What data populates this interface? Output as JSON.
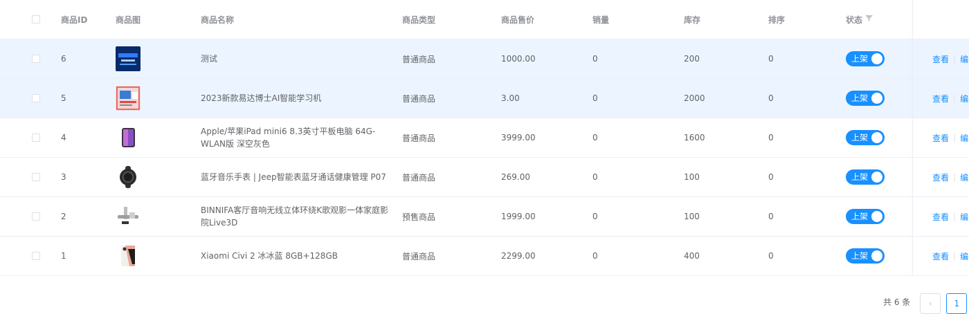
{
  "columns": {
    "id": "商品ID",
    "image": "商品图",
    "name": "商品名称",
    "type": "商品类型",
    "price": "商品售价",
    "sales": "销量",
    "stock": "库存",
    "sort": "排序",
    "status": "状态"
  },
  "rows": [
    {
      "id": "6",
      "name": "测试",
      "type": "普通商品",
      "price": "1000.00",
      "sales": "0",
      "stock": "200",
      "sort": "0",
      "status": "上架",
      "view": "查看",
      "edit": "编"
    },
    {
      "id": "5",
      "name": "2023新款易达博士AI智能学习机",
      "type": "普通商品",
      "price": "3.00",
      "sales": "0",
      "stock": "2000",
      "sort": "0",
      "status": "上架",
      "view": "查看",
      "edit": "编"
    },
    {
      "id": "4",
      "name": "Apple/苹果iPad mini6 8.3英寸平板电脑 64G-WLAN版 深空灰色",
      "type": "普通商品",
      "price": "3999.00",
      "sales": "0",
      "stock": "1600",
      "sort": "0",
      "status": "上架",
      "view": "查看",
      "edit": "编"
    },
    {
      "id": "3",
      "name": "蓝牙音乐手表 | Jeep智能表蓝牙通话健康管理 P07",
      "type": "普通商品",
      "price": "269.00",
      "sales": "0",
      "stock": "100",
      "sort": "0",
      "status": "上架",
      "view": "查看",
      "edit": "编"
    },
    {
      "id": "2",
      "name": "BINNIFA客厅音响无线立体环绕K歌观影一体家庭影院Live3D",
      "type": "预售商品",
      "price": "1999.00",
      "sales": "0",
      "stock": "100",
      "sort": "0",
      "status": "上架",
      "view": "查看",
      "edit": "编"
    },
    {
      "id": "1",
      "name": "Xiaomi Civi 2 冰冰蓝 8GB+128GB",
      "type": "普通商品",
      "price": "2299.00",
      "sales": "0",
      "stock": "400",
      "sort": "0",
      "status": "上架",
      "view": "查看",
      "edit": "编"
    }
  ],
  "pagination": {
    "total": "共 6 条",
    "current": "1"
  },
  "colors": {
    "accent": "#1890ff",
    "row_highlight": "#ecf5ff"
  }
}
